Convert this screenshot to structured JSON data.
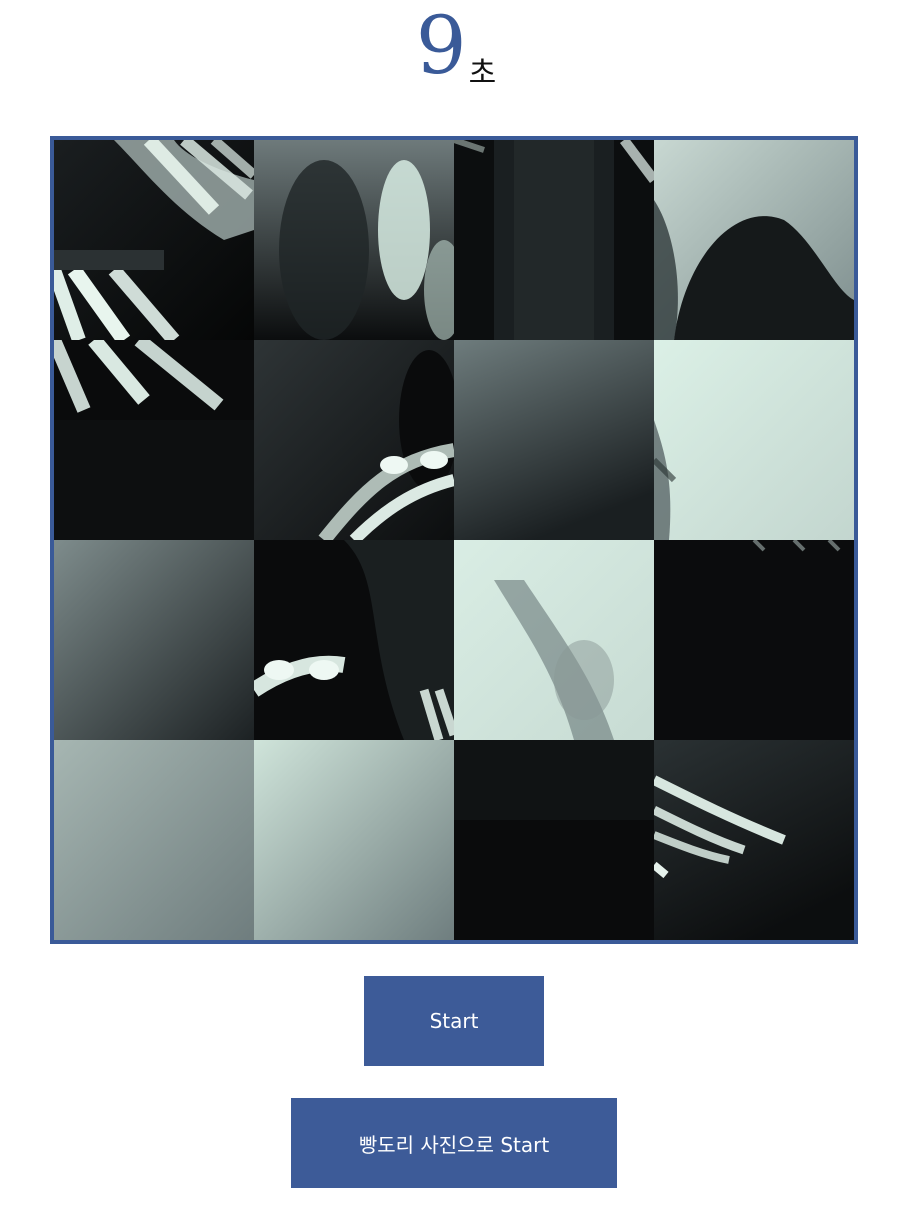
{
  "timer": {
    "value": "9",
    "unit": "초"
  },
  "board": {
    "grid_size": 4,
    "tiles": [
      {
        "id": "tile-1"
      },
      {
        "id": "tile-2"
      },
      {
        "id": "tile-3"
      },
      {
        "id": "tile-4"
      },
      {
        "id": "tile-5"
      },
      {
        "id": "tile-6"
      },
      {
        "id": "tile-7"
      },
      {
        "id": "tile-8"
      },
      {
        "id": "tile-9"
      },
      {
        "id": "tile-10"
      },
      {
        "id": "tile-11"
      },
      {
        "id": "tile-12"
      },
      {
        "id": "tile-13"
      },
      {
        "id": "tile-14"
      },
      {
        "id": "tile-15"
      },
      {
        "id": "tile-16"
      }
    ]
  },
  "buttons": {
    "start_label": "Start",
    "alt_start_label": "빵도리 사진으로 Start"
  },
  "colors": {
    "accent": "#3a5a98",
    "button": "#3d5b98",
    "board_border": "#3a5a98"
  }
}
